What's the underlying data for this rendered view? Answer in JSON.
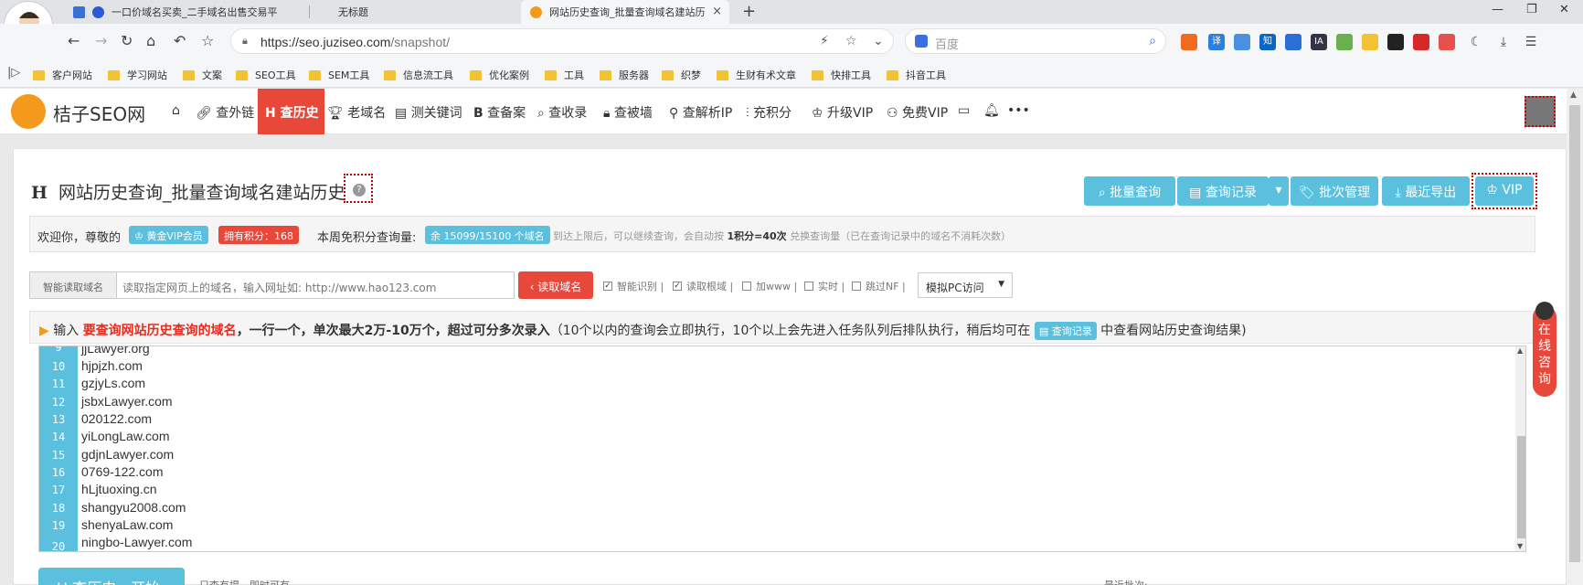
{
  "browser": {
    "tabs": [
      {
        "label": "一口价域名买卖_二手域名出售交易平",
        "color": "#3a6fd8"
      },
      {
        "label": "无标题",
        "color": "#888888"
      },
      {
        "label": "网站历史查询_批量查询域名建站历",
        "color": "#f39a1d"
      }
    ],
    "close_glyph": "×",
    "new_tab": "+",
    "url_host": "https://seo.juziseo.com",
    "url_path": "/snapshot/",
    "search_placeholder": "百度",
    "bookmarks": [
      "客户网站",
      "学习网站",
      "文案",
      "SEO工具",
      "SEM工具",
      "信息流工具",
      "优化案例",
      "工具",
      "服务器",
      "织梦",
      "生财有术文章",
      "快排工具",
      "抖音工具"
    ]
  },
  "site": {
    "logo_text": "桔子SEO网",
    "nav": [
      "查外链",
      "查历史",
      "老域名",
      "测关键词",
      "查备案",
      "查收录",
      "查被墙",
      "查解析IP",
      "充积分",
      "升级VIP",
      "免费VIP"
    ],
    "active_nav": "查历史",
    "nav_more": "•••"
  },
  "page": {
    "title_prefix": "H",
    "title": "网站历史查询_批量查询域名建站历史",
    "help": "?",
    "buttons": {
      "batch_query": "批量查询",
      "query_record": "查询记录",
      "batch_manage": "批次管理",
      "recent_export": "最近导出",
      "vip": "VIP"
    },
    "welcome": {
      "greeting": "欢迎你，尊敬的",
      "member_badge": "黄金VIP会员",
      "points_badge": "拥有积分：168",
      "free_label": "本周免积分查询量:",
      "quota_badge": "余 15099/15100 个域名",
      "note": "到达上限后，可以继续查询，会自动按",
      "rate": "1积分=40次",
      "note2": "兑换查询量（已在查询记录中的域名不消耗次数）"
    },
    "reader": {
      "label": "智能读取域名",
      "placeholder": "读取指定网页上的域名，输入网址如: http://www.hao123.com",
      "button": "读取域名",
      "options": [
        {
          "label": "智能识别 |",
          "checked": true
        },
        {
          "label": "读取根域 |",
          "checked": true
        },
        {
          "label": "加www |",
          "checked": false
        },
        {
          "label": "实时 |",
          "checked": false
        },
        {
          "label": "跳过NF |",
          "checked": false
        }
      ],
      "mode": "模拟PC访问"
    },
    "instruction": {
      "prefix": "输入",
      "red": "要查询网站历史查询的域名",
      "bold": "，一行一个，单次最大2万-10万个，超过可分多次录入",
      "rest": "（10个以内的查询会立即执行，10个以上会先进入任务队列后排队执行，稍后均可在",
      "mini_btn": "查询记录",
      "suffix": "中查看网站历史查询结果)"
    },
    "editor_lines": [
      {
        "n": "9",
        "text": "jjLawyer.org"
      },
      {
        "n": "10",
        "text": "hjpjzh.com"
      },
      {
        "n": "11",
        "text": "gzjyLs.com"
      },
      {
        "n": "12",
        "text": "jsbxLawyer.com"
      },
      {
        "n": "13",
        "text": "020122.com"
      },
      {
        "n": "14",
        "text": "yiLongLaw.com"
      },
      {
        "n": "15",
        "text": "gdjnLawyer.com"
      },
      {
        "n": "16",
        "text": "0769-122.com"
      },
      {
        "n": "17",
        "text": "hLjtuoxing.cn"
      },
      {
        "n": "18",
        "text": "shangyu2008.com"
      },
      {
        "n": "19",
        "text": "shenyaLaw.com"
      },
      {
        "n": "20",
        "text": "ningbo-Lawyer.com"
      }
    ],
    "start_button": "H 查历史，开始",
    "bottom_hint": "只查有提，即时可有",
    "recent_label": "最近批次:",
    "consult": "在线咨询"
  }
}
